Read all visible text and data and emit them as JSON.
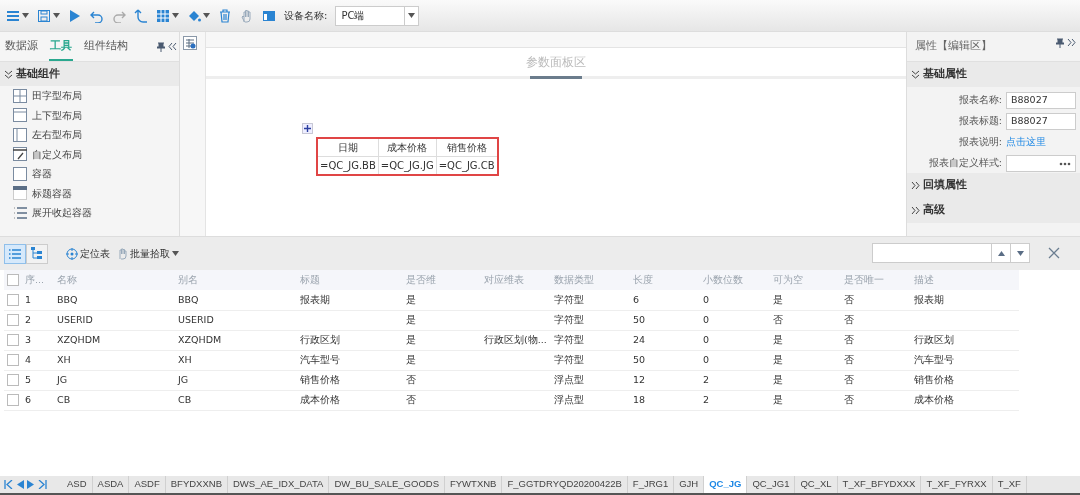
{
  "toolbar": {
    "device_label": "设备名称:",
    "device_value": "PC端"
  },
  "left_panel": {
    "tabs": [
      {
        "label": "数据源",
        "selected": false
      },
      {
        "label": "工具",
        "selected": true
      },
      {
        "label": "组件结构",
        "selected": false
      }
    ],
    "section": "基础组件",
    "items": [
      {
        "label": "田字型布局",
        "kind": "grid4"
      },
      {
        "label": "上下型布局",
        "kind": "topbottom"
      },
      {
        "label": "左右型布局",
        "kind": "leftright"
      },
      {
        "label": "自定义布局",
        "kind": "custom"
      },
      {
        "label": "容器",
        "kind": "container"
      },
      {
        "label": "标题容器",
        "kind": "titled"
      },
      {
        "label": "展开收起容器",
        "kind": "list"
      }
    ]
  },
  "canvas": {
    "param_panel": "参数面板区",
    "report": {
      "headers": [
        "日期",
        "成本价格",
        "销售价格"
      ],
      "cells": [
        "=QC_JG.BB",
        "=QC_JG.JG",
        "=QC_JG.CB"
      ]
    }
  },
  "right_panel": {
    "title": "属性【编辑区】",
    "sections": [
      {
        "title": "基础属性",
        "expanded": true
      },
      {
        "title": "回填属性",
        "expanded": false
      },
      {
        "title": "高级",
        "expanded": false
      }
    ],
    "fields": [
      {
        "label": "报表名称:",
        "kind": "input",
        "value": "B88027"
      },
      {
        "label": "报表标题:",
        "kind": "input",
        "value": "B88027"
      },
      {
        "label": "报表说明:",
        "kind": "link",
        "value": "点击这里"
      },
      {
        "label": "报表自定义样式:",
        "kind": "picker"
      }
    ]
  },
  "bottom_toolbar": {
    "views": [
      {
        "kind": "list",
        "selected": true
      },
      {
        "kind": "tree",
        "selected": false
      }
    ],
    "locate": "定位表",
    "batch": "批量拾取"
  },
  "table": {
    "select_all_checked": false,
    "columns": [
      "序...",
      "名称",
      "别名",
      "标题",
      "是否维",
      "对应维表",
      "数据类型",
      "长度",
      "小数位数",
      "可为空",
      "是否唯一",
      "描述"
    ],
    "rows": [
      {
        "checked": false,
        "cells": [
          "1",
          "BBQ",
          "BBQ",
          "报表期",
          "是",
          "",
          "字符型",
          "6",
          "0",
          "是",
          "否",
          "报表期"
        ]
      },
      {
        "checked": false,
        "cells": [
          "2",
          "USERID",
          "USERID",
          "",
          "是",
          "",
          "字符型",
          "50",
          "0",
          "否",
          "否",
          ""
        ]
      },
      {
        "checked": false,
        "cells": [
          "3",
          "XZQHDM",
          "XZQHDM",
          "行政区划",
          "是",
          "行政区划(物...",
          "字符型",
          "24",
          "0",
          "是",
          "否",
          "行政区划"
        ]
      },
      {
        "checked": false,
        "cells": [
          "4",
          "XH",
          "XH",
          "汽车型号",
          "是",
          "",
          "字符型",
          "50",
          "0",
          "是",
          "否",
          "汽车型号"
        ]
      },
      {
        "checked": false,
        "cells": [
          "5",
          "JG",
          "JG",
          "销售价格",
          "否",
          "",
          "浮点型",
          "12",
          "2",
          "是",
          "否",
          "销售价格"
        ]
      },
      {
        "checked": false,
        "cells": [
          "6",
          "CB",
          "CB",
          "成本价格",
          "否",
          "",
          "浮点型",
          "18",
          "2",
          "是",
          "否",
          "成本价格"
        ]
      }
    ]
  },
  "sheet_tabs": [
    {
      "label": "ASD",
      "selected": false
    },
    {
      "label": "ASDA",
      "selected": false
    },
    {
      "label": "ASDF",
      "selected": false
    },
    {
      "label": "BFYDXXNB",
      "selected": false
    },
    {
      "label": "DWS_AE_IDX_DATA",
      "selected": false
    },
    {
      "label": "DW_BU_SALE_GOODS",
      "selected": false
    },
    {
      "label": "FYWTXNB",
      "selected": false
    },
    {
      "label": "F_GGTDRYQD20200422B",
      "selected": false
    },
    {
      "label": "F_JRG1",
      "selected": false
    },
    {
      "label": "GJH",
      "selected": false
    },
    {
      "label": "QC_JG",
      "selected": true
    },
    {
      "label": "QC_JG1",
      "selected": false
    },
    {
      "label": "QC_XL",
      "selected": false
    },
    {
      "label": "T_XF_BFYDXXX",
      "selected": false
    },
    {
      "label": "T_XF_FYRXX",
      "selected": false
    },
    {
      "label": "T_XF",
      "selected": false
    }
  ]
}
